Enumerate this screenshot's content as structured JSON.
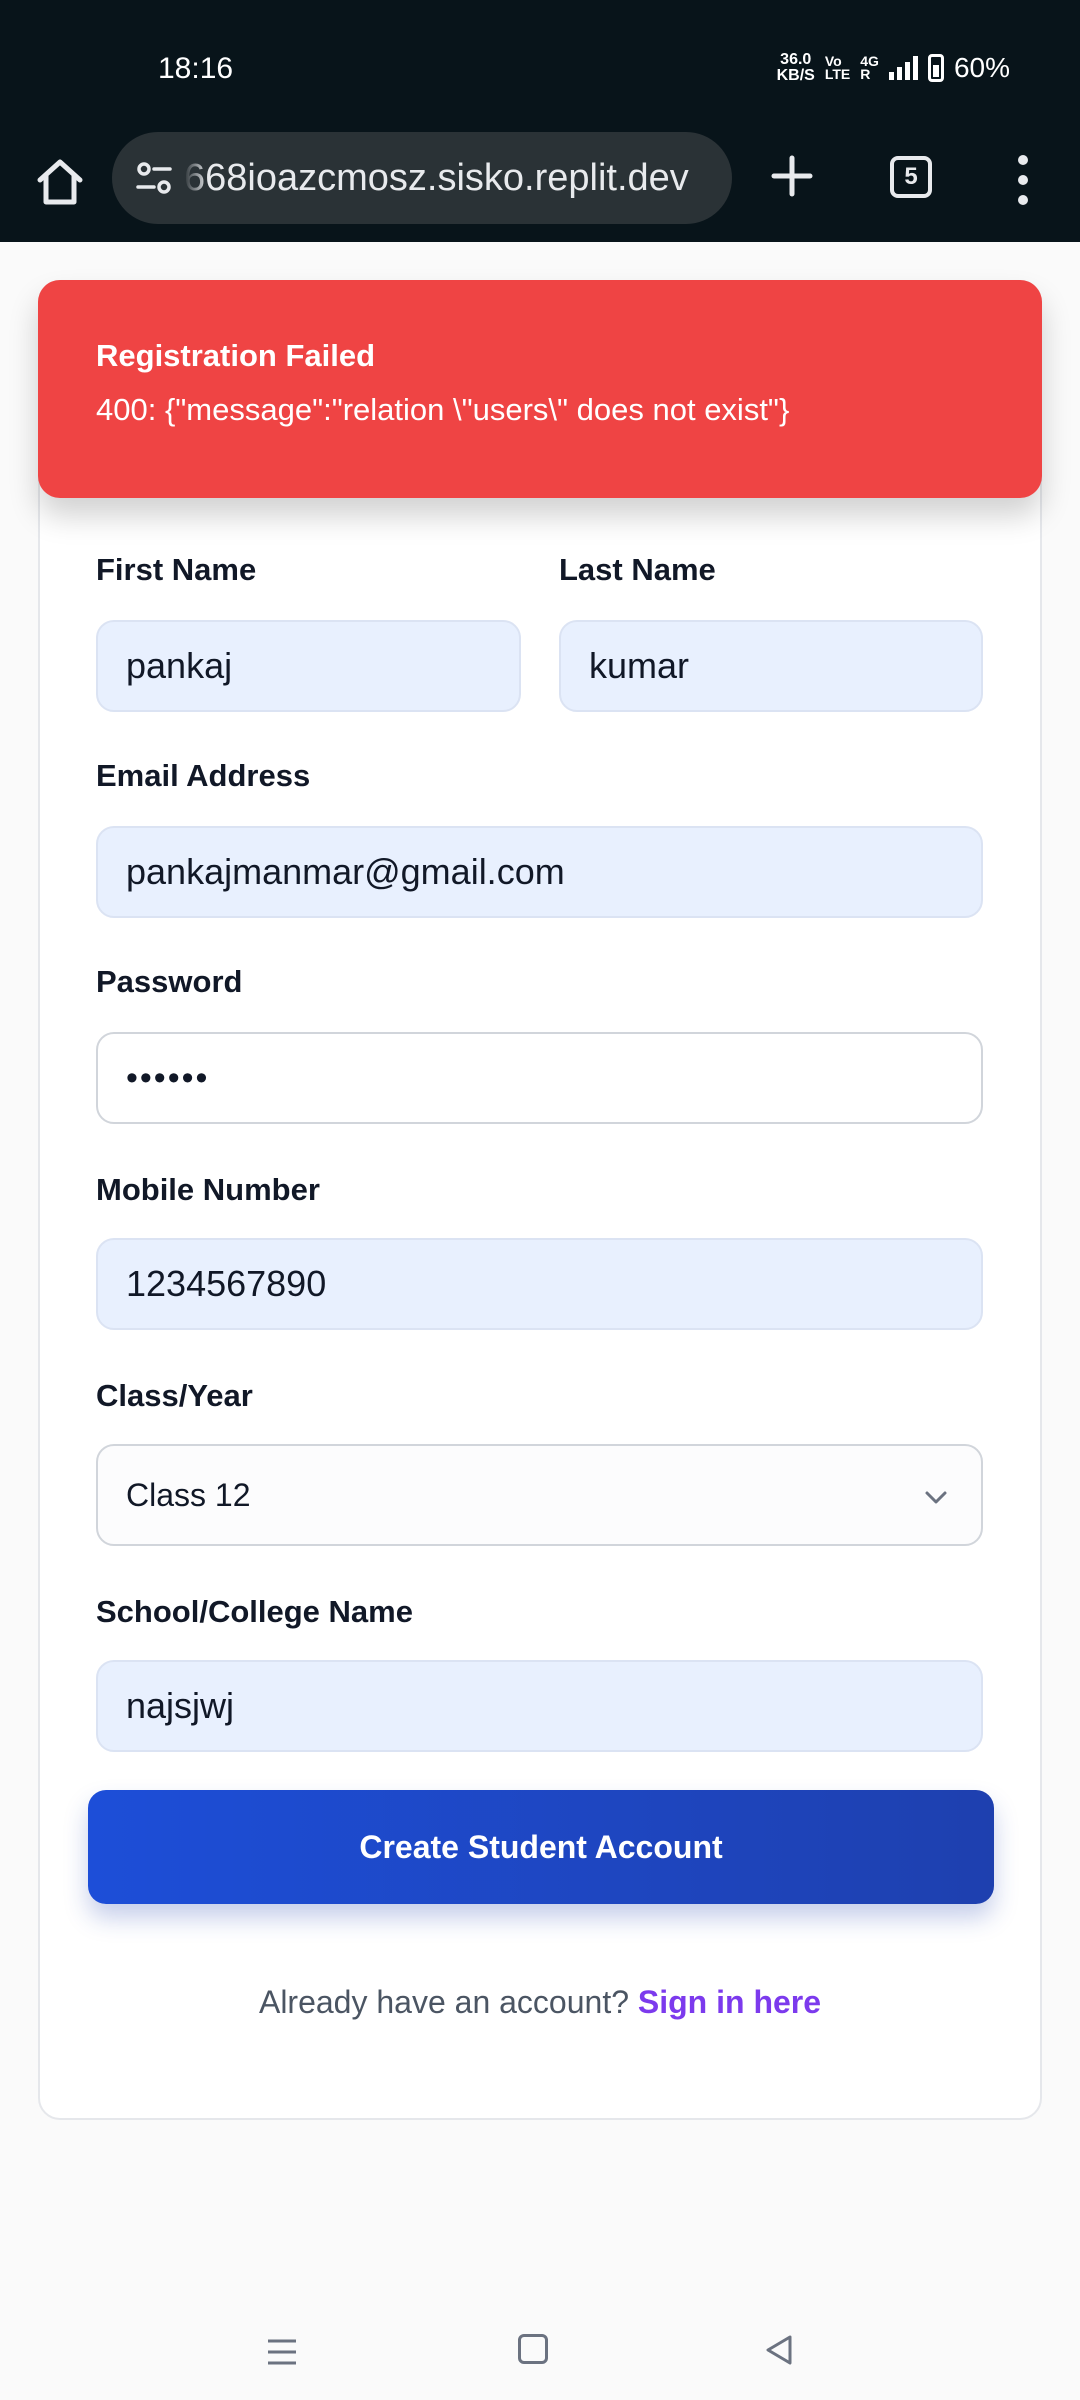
{
  "status_bar": {
    "time": "18:16",
    "net_speed_value": "36.0",
    "net_speed_unit": "KB/S",
    "volte_top": "Vo",
    "volte_bottom": "LTE",
    "network_top": "4G",
    "network_bottom": "R",
    "battery": "60%"
  },
  "browser": {
    "url": "668ioazcmosz.sisko.replit.dev",
    "tab_count": "5"
  },
  "toast": {
    "title": "Registration Failed",
    "message": "400: {\"message\":\"relation \\\"users\\\" does not exist\"}",
    "color": "#ef4444"
  },
  "form": {
    "first_name_label": "First Name",
    "first_name_value": "pankaj",
    "last_name_label": "Last Name",
    "last_name_value": "kumar",
    "email_label": "Email Address",
    "email_value": "pankajmanmar@gmail.com",
    "password_label": "Password",
    "password_value": "••••••",
    "mobile_label": "Mobile Number",
    "mobile_value": "1234567890",
    "class_label": "Class/Year",
    "class_value": "Class 12",
    "school_label": "School/College Name",
    "school_value": "najsjwj",
    "submit_label": "Create Student Account",
    "signin_prompt": "Already have an account?",
    "signin_link": "Sign in here"
  },
  "colors": {
    "accent": "#1d4ed8",
    "link": "#7c3aed",
    "autofill": "#e8f0fe"
  }
}
